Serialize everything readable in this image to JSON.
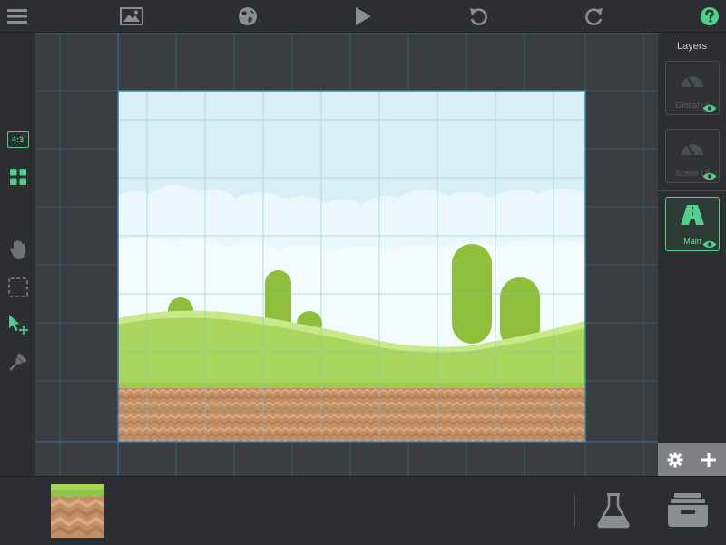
{
  "toolbar": {
    "items": [
      {
        "name": "menu-button",
        "icon": "hamburger-menu-icon"
      },
      {
        "name": "image-button",
        "icon": "image-icon"
      },
      {
        "name": "globe-button",
        "icon": "globe-icon"
      },
      {
        "name": "play-button",
        "icon": "play-icon"
      },
      {
        "name": "undo-button",
        "icon": "undo-icon"
      },
      {
        "name": "redo-button",
        "icon": "redo-icon"
      },
      {
        "name": "help-button",
        "icon": "help-circle-icon"
      }
    ]
  },
  "left_tools": {
    "aspect_ratio_label": "4:3",
    "items": [
      {
        "name": "aspect-ratio-button",
        "icon": "aspect-ratio-icon"
      },
      {
        "name": "grid-button",
        "icon": "grid-icon"
      },
      {
        "name": "pan-tool-button",
        "icon": "hand-icon"
      },
      {
        "name": "marquee-select-button",
        "icon": "dashed-square-icon"
      },
      {
        "name": "select-move-button",
        "icon": "cursor-move-icon"
      },
      {
        "name": "paint-tool-button",
        "icon": "brush-icon"
      }
    ]
  },
  "layers": {
    "title": "Layers",
    "items": [
      {
        "label": "Global UI",
        "icon": "speedometer-icon",
        "active": false
      },
      {
        "label": "Scene UI",
        "icon": "speedometer-icon",
        "active": false
      },
      {
        "label": "Main",
        "icon": "road-icon",
        "active": true
      }
    ],
    "settings_icon": "gear-icon",
    "add_icon": "plus-icon"
  },
  "bottom": {
    "tile_icon": "grass-dirt-tile",
    "flask_icon": "flask-icon",
    "archive_icon": "archive-box-icon"
  },
  "colors": {
    "accent": "#4fd08a",
    "icon_gray": "#8a8d92",
    "sky": "#d8eef5",
    "grass": "#a8d45a",
    "dirt": "#c9956a"
  }
}
